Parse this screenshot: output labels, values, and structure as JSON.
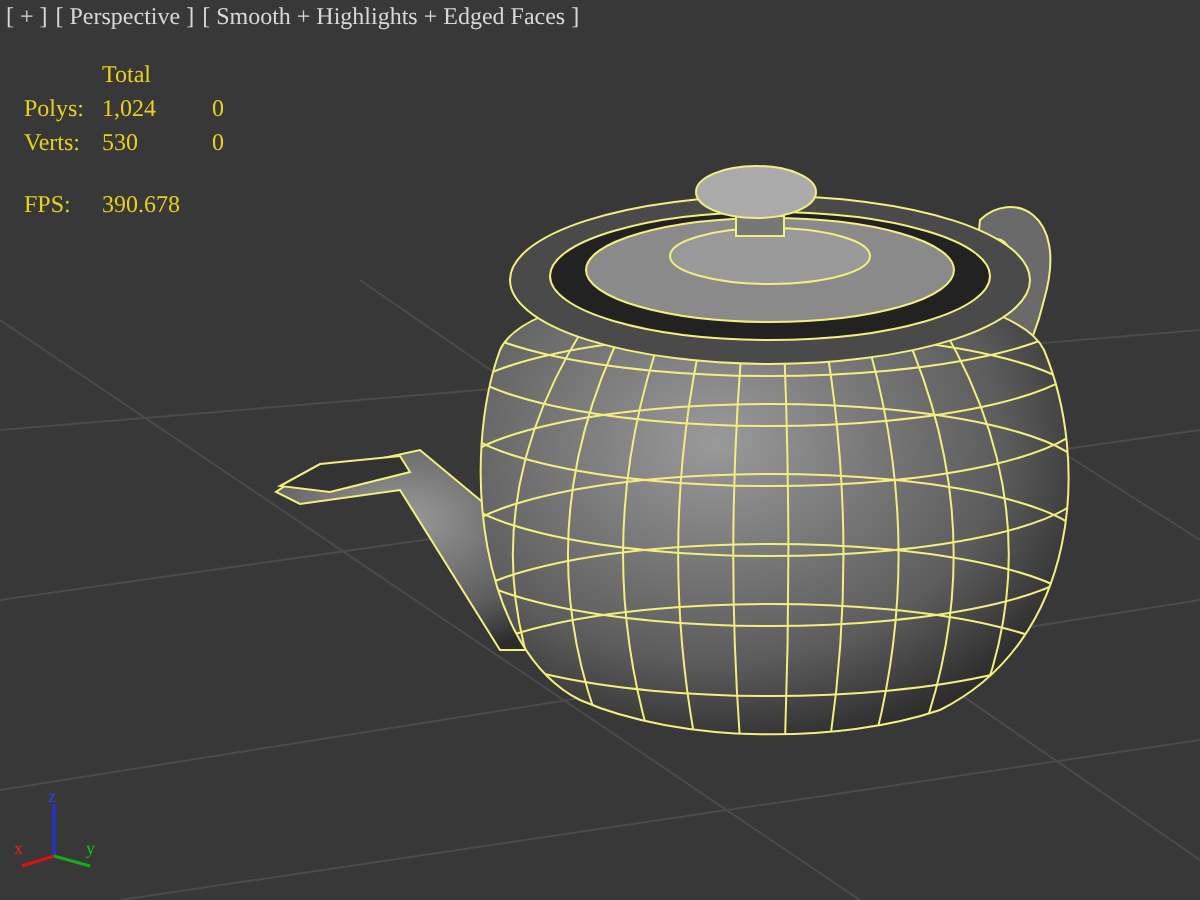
{
  "viewport_labels": [
    {
      "label": "[ + ]"
    },
    {
      "label": "[ Perspective ]"
    },
    {
      "label": "[ Smooth + Highlights + Edged Faces ]"
    }
  ],
  "statistics": {
    "header": "Total",
    "rows": [
      {
        "label": "Polys:",
        "total": "1,024",
        "selected": "0"
      },
      {
        "label": "Verts:",
        "total": "530",
        "selected": "0"
      }
    ],
    "fps_label": "FPS:",
    "fps": "390.678"
  },
  "axis_gizmo": {
    "x": "x",
    "y": "y",
    "z": "z"
  }
}
